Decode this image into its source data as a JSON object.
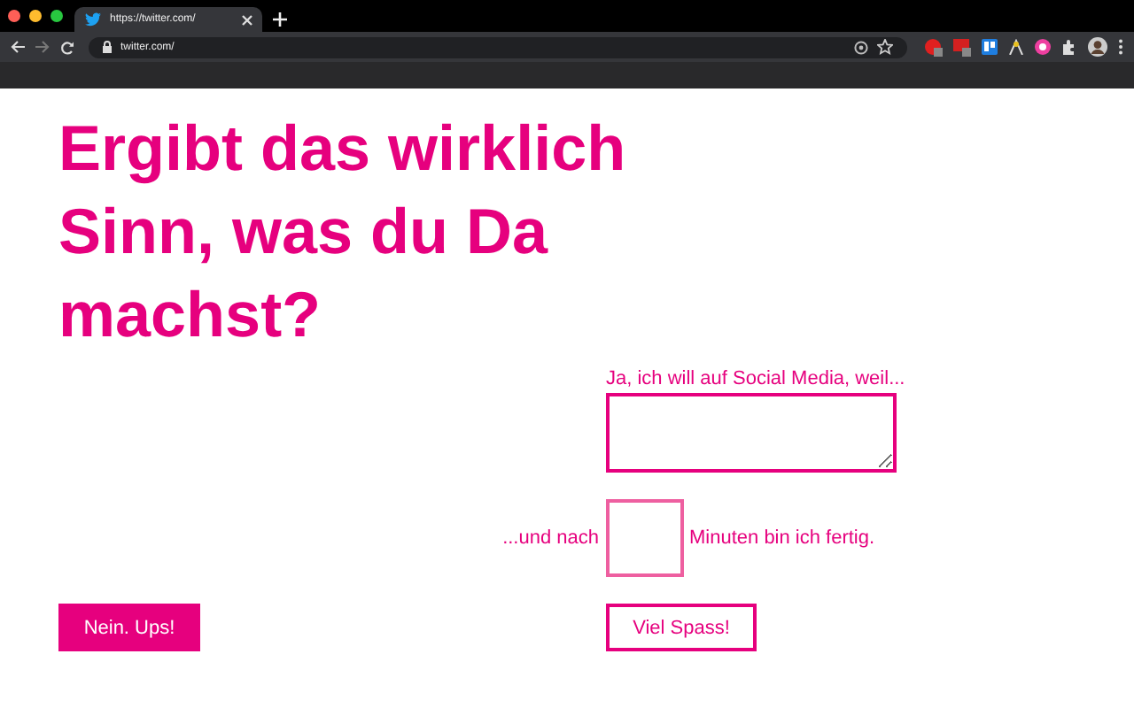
{
  "browser": {
    "tab": {
      "title": "https://twitter.com/",
      "selected": true
    },
    "address": "twitter.com/"
  },
  "page": {
    "heading": "Ergibt das wirklich Sinn, was du Da machst?",
    "reason_label": "Ja, ich will auf Social Media, weil...",
    "minutes_before": "...und nach",
    "minutes_after": "Minuten bin ich fertig.",
    "buttons": [
      {
        "label": "Nein. Ups!",
        "kind": "filled"
      },
      {
        "label": "Viel Spass!",
        "kind": "outline"
      }
    ]
  }
}
